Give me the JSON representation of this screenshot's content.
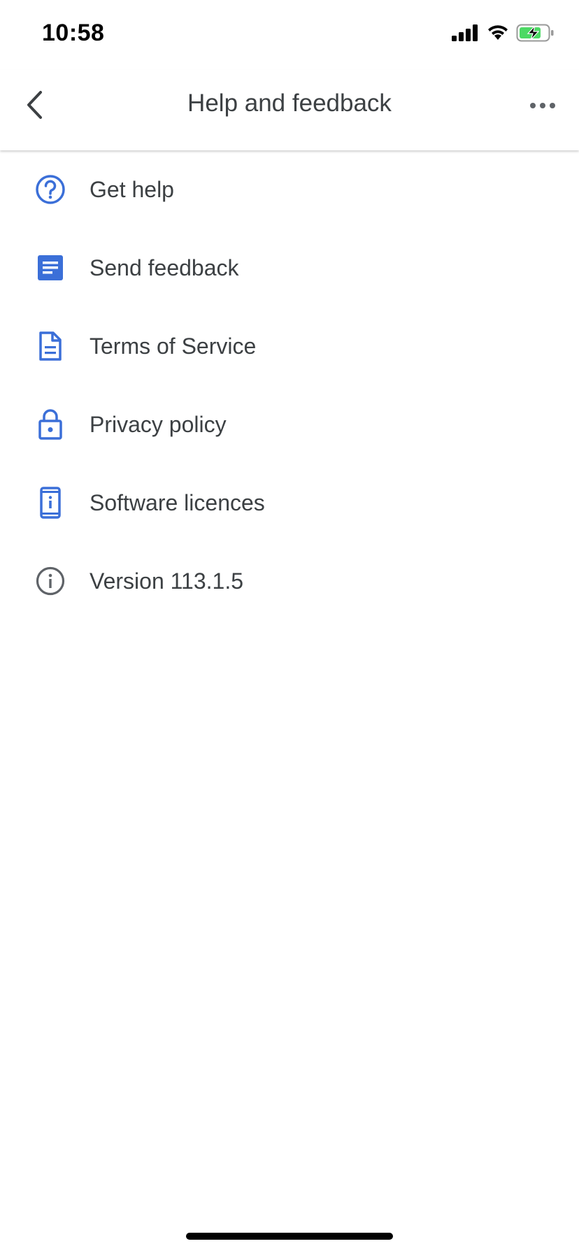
{
  "status_bar": {
    "time": "10:58",
    "icons": [
      "signal-icon",
      "wifi-icon",
      "battery-charging-icon"
    ]
  },
  "app_bar": {
    "title": "Help and feedback",
    "back_icon": "chevron-left-icon",
    "more_icon": "more-horizontal-icon"
  },
  "menu": {
    "items": [
      {
        "label": "Get help",
        "icon": "help-circle-icon"
      },
      {
        "label": "Send feedback",
        "icon": "feedback-doc-icon"
      },
      {
        "label": "Terms of Service",
        "icon": "document-icon"
      },
      {
        "label": "Privacy policy",
        "icon": "lock-icon"
      },
      {
        "label": "Software licences",
        "icon": "device-info-icon"
      },
      {
        "label": "Version 113.1.5",
        "icon": "info-icon"
      }
    ]
  },
  "colors": {
    "accent": "#3b6fd8",
    "text": "#3c4043",
    "icon_grey": "#5f6368",
    "battery_green": "#4cd964"
  }
}
